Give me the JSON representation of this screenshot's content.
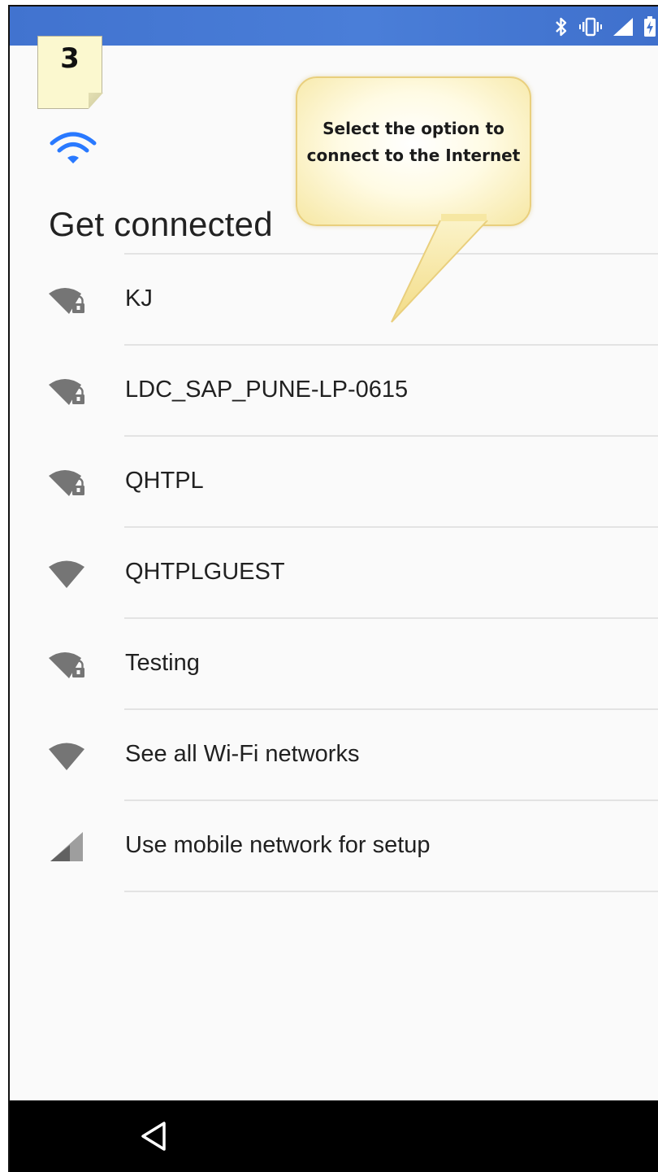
{
  "step_note": {
    "number": "3"
  },
  "callout": {
    "text": "Select the option to connect to the Internet"
  },
  "screen": {
    "title": "Get connected"
  },
  "networks": [
    {
      "label": "KJ",
      "icon": "wifi-locked-icon"
    },
    {
      "label": "LDC_SAP_PUNE-LP-0615",
      "icon": "wifi-locked-icon"
    },
    {
      "label": "QHTPL",
      "icon": "wifi-locked-icon"
    },
    {
      "label": "QHTPLGUEST",
      "icon": "wifi-open-icon"
    },
    {
      "label": "Testing",
      "icon": "wifi-locked-icon"
    },
    {
      "label": "See all Wi-Fi networks",
      "icon": "wifi-open-icon"
    },
    {
      "label": "Use mobile network for setup",
      "icon": "cellular-signal-icon"
    }
  ],
  "status_bar": {
    "icons": [
      "bluetooth-icon",
      "vibrate-icon",
      "cellular-signal-icon",
      "battery-charging-icon"
    ],
    "color": "#4a7ed8"
  },
  "nav_bar": {
    "icons": [
      "back-icon"
    ]
  },
  "colors": {
    "accent": "#2979ff",
    "icon_gray": "#757575",
    "text": "#212121"
  }
}
